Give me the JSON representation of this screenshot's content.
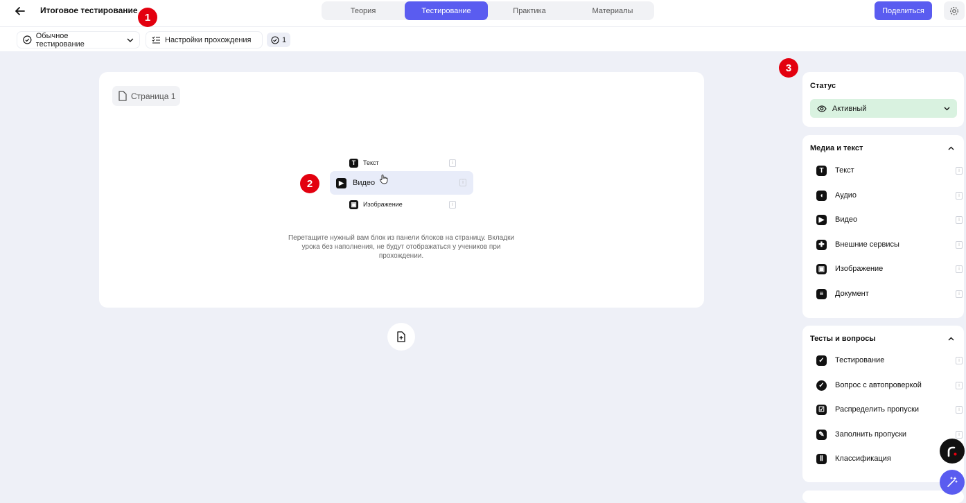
{
  "header": {
    "title": "Итоговое тестирование",
    "tabs": [
      "Теория",
      "Тестирование",
      "Практика",
      "Материалы"
    ],
    "active_tab": "Тестирование",
    "share_label": "Поделиться"
  },
  "toolbar": {
    "mode_label": "Обычное тестирование",
    "settings_label": "Настройки прохождения",
    "count": "1"
  },
  "markers": [
    "1",
    "2",
    "3"
  ],
  "canvas": {
    "page_chip": "Страница 1",
    "drag_items": [
      "Текст",
      "Видео",
      "Изображение"
    ],
    "drop_hint": "Перетащите нужный вам блок из панели блоков на страницу. Вкладки урока без наполнения, не будут отображаться у учеников при прохождении."
  },
  "sidebar": {
    "status": {
      "title": "Статус",
      "value": "Активный",
      "color": "#d9f2e0"
    },
    "media": {
      "title": "Медиа и текст",
      "items": [
        "Текст",
        "Аудио",
        "Видео",
        "Внешние сервисы",
        "Изображение",
        "Документ"
      ]
    },
    "tests": {
      "title": "Тесты и вопросы",
      "items": [
        "Тестирование",
        "Вопрос с автопроверкой",
        "Распределить пропуски",
        "Заполнить пропуски",
        "Классификация"
      ]
    }
  },
  "colors": {
    "accent": "#5a5cf0",
    "marker": "#e3000f",
    "background": "#eef0f7"
  }
}
